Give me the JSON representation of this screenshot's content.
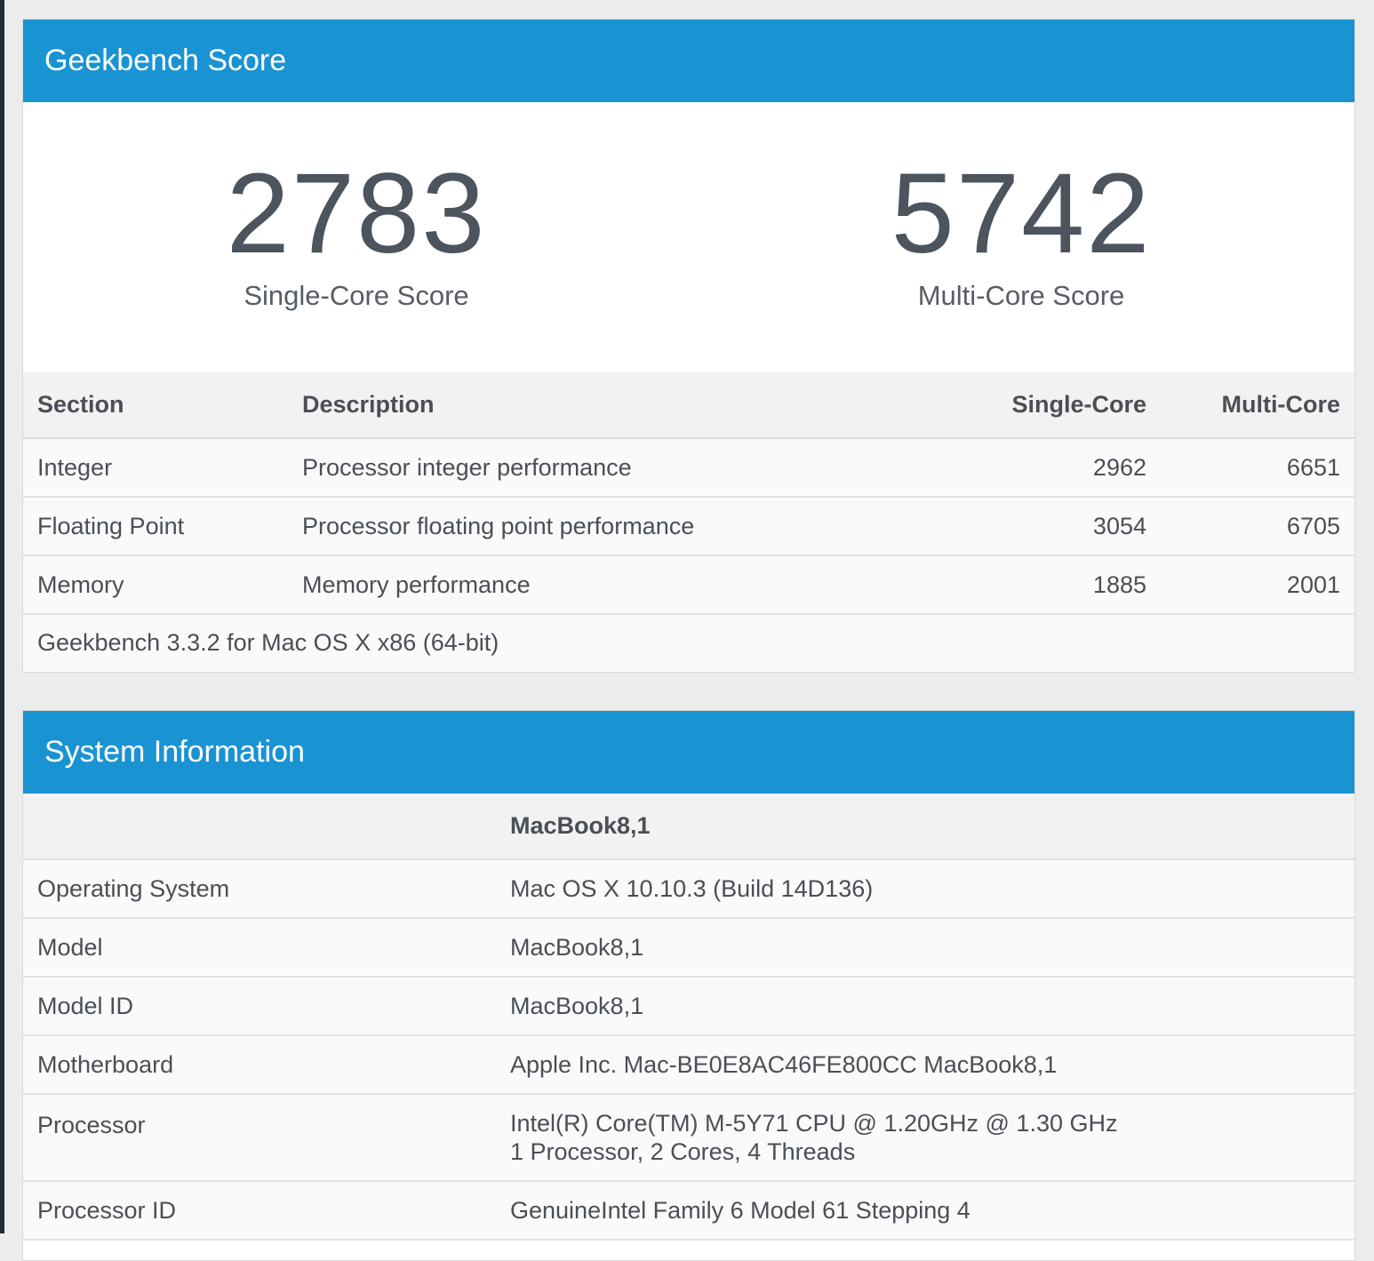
{
  "score_panel": {
    "title": "Geekbench Score",
    "single_core": {
      "value": "2783",
      "label": "Single-Core Score"
    },
    "multi_core": {
      "value": "5742",
      "label": "Multi-Core Score"
    },
    "table": {
      "headers": {
        "section": "Section",
        "description": "Description",
        "single": "Single-Core",
        "multi": "Multi-Core"
      },
      "rows": [
        {
          "section": "Integer",
          "description": "Processor integer performance",
          "single": "2962",
          "multi": "6651"
        },
        {
          "section": "Floating Point",
          "description": "Processor floating point performance",
          "single": "3054",
          "multi": "6705"
        },
        {
          "section": "Memory",
          "description": "Memory performance",
          "single": "1885",
          "multi": "2001"
        }
      ],
      "footer": "Geekbench 3.3.2 for Mac OS X x86 (64-bit)"
    }
  },
  "sysinfo_panel": {
    "title": "System Information",
    "header_value": "MacBook8,1",
    "rows": [
      {
        "key": "Operating System",
        "value": "Mac OS X 10.10.3 (Build 14D136)"
      },
      {
        "key": "Model",
        "value": "MacBook8,1"
      },
      {
        "key": "Model ID",
        "value": "MacBook8,1"
      },
      {
        "key": "Motherboard",
        "value": "Apple Inc. Mac-BE0E8AC46FE800CC MacBook8,1"
      },
      {
        "key": "Processor",
        "value": "Intel(R) Core(TM) M-5Y71 CPU @ 1.20GHz @ 1.30 GHz",
        "value2": "1 Processor, 2 Cores, 4 Threads"
      },
      {
        "key": "Processor ID",
        "value": "GenuineIntel Family 6 Model 61 Stepping 4"
      }
    ]
  },
  "colors": {
    "header_blue": "#1a93d2",
    "text": "#4a4f56"
  }
}
